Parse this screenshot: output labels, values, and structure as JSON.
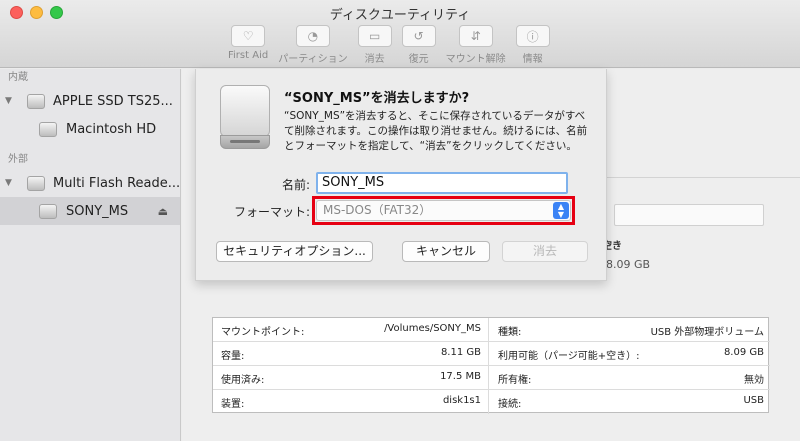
{
  "window": {
    "title": "ディスクユーティリティ"
  },
  "toolbar": {
    "items": [
      {
        "label": "First Aid",
        "icon": "stethoscope-icon"
      },
      {
        "label": "パーティション",
        "icon": "partition-icon"
      },
      {
        "label": "消去",
        "icon": "erase-icon"
      },
      {
        "label": "復元",
        "icon": "restore-icon"
      },
      {
        "label": "マウント解除",
        "icon": "unmount-icon"
      },
      {
        "label": "情報",
        "icon": "info-icon"
      }
    ]
  },
  "sidebar": {
    "internal_label": "内蔵",
    "external_label": "外部",
    "items": [
      {
        "label": "APPLE SSD TS25..."
      },
      {
        "label": "Macintosh HD"
      },
      {
        "label": "Multi Flash Reade..."
      },
      {
        "label": "SONY_MS"
      }
    ]
  },
  "background": {
    "partial_label": "空き",
    "partial_value": "8.09 GB"
  },
  "dialog": {
    "title": "“SONY_MS”を消去しますか?",
    "message": "“SONY_MS”を消去すると、そこに保存されているデータがすべて削除されます。この操作は取り消せません。続けるには、名前とフォーマットを指定して、“消去”をクリックしてください。",
    "name_label": "名前:",
    "name_value": "SONY_MS",
    "format_label": "フォーマット:",
    "format_value": "MS-DOS（FAT32）",
    "security_button": "セキュリティオプション...",
    "cancel_button": "キャンセル",
    "erase_button": "消去"
  },
  "info": {
    "rows": [
      {
        "k1": "マウントポイント:",
        "v1": "/Volumes/SONY_MS",
        "k2": "種類:",
        "v2": "USB 外部物理ボリューム"
      },
      {
        "k1": "容量:",
        "v1": "8.11 GB",
        "k2": "利用可能（パージ可能+空き）:",
        "v2": "8.09 GB"
      },
      {
        "k1": "使用済み:",
        "v1": "17.5 MB",
        "k2": "所有権:",
        "v2": "無効"
      },
      {
        "k1": "装置:",
        "v1": "disk1s1",
        "k2": "接続:",
        "v2": "USB"
      }
    ]
  },
  "colors": {
    "highlight": "#e60012",
    "accent": "#3b83f5"
  }
}
